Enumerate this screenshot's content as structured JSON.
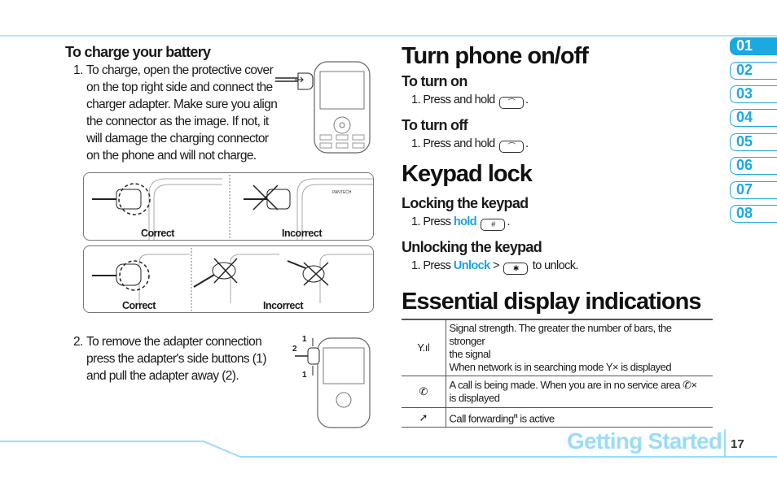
{
  "left": {
    "heading": "To charge your battery",
    "step1_num": "1.",
    "step1_lines": [
      "To charge, open the protective cover",
      "on the top right side and connect the",
      "charger adapter. Make sure you align",
      "the connector as the image. If not, it",
      "will damage the charging connector",
      "on the phone and will not charge."
    ],
    "figure1": {
      "left_caption": "Correct",
      "right_caption": "Incorrect",
      "brand": "PANTECH"
    },
    "figure2": {
      "left_caption": "Correct",
      "right_caption": "Incorrect"
    },
    "step2_num": "2.",
    "step2_lines": [
      "To remove the adapter connection",
      "press the adapter's side buttons (1)",
      "and pull the adapter away (2)."
    ],
    "step2_labels": [
      "1",
      "2",
      "1"
    ]
  },
  "right": {
    "turn_title": "Turn phone on/off",
    "turn_on_heading": "To turn on",
    "turn_on_item": "1. Press and hold",
    "turn_off_heading": "To turn off",
    "turn_off_item": "1. Press and hold",
    "keypad_title": "Keypad lock",
    "lock_heading": "Locking the keypad",
    "lock_item_pre": "1. Press",
    "lock_item_key": "hold",
    "unlock_heading": "Unlocking the keypad",
    "unlock_item_pre": "1. Press",
    "unlock_item_key": "Unlock",
    "unlock_item_mid": ">",
    "unlock_item_post": "to unlock.",
    "display_title": "Essential display indications",
    "rows": [
      {
        "icon": "signal-strength-icon",
        "lines": [
          "Signal strength. The greater the number of bars, the stronger",
          "the signal",
          "When network is in searching mode",
          "is displayed"
        ]
      },
      {
        "icon": "call-icon",
        "lines": [
          "A call is being made. When you are in no service area",
          "is displayed"
        ]
      },
      {
        "icon": "call-forwarding-icon",
        "lines": [
          "Call forwarding",
          "n",
          " is active"
        ]
      }
    ]
  },
  "tabs": [
    "01",
    "02",
    "03",
    "04",
    "05",
    "06",
    "07",
    "08"
  ],
  "active_tab": "01",
  "footer": {
    "section": "Getting Started",
    "page": "17"
  },
  "colors": {
    "accent": "#1ba9e1",
    "light_accent": "#9adcf5"
  }
}
